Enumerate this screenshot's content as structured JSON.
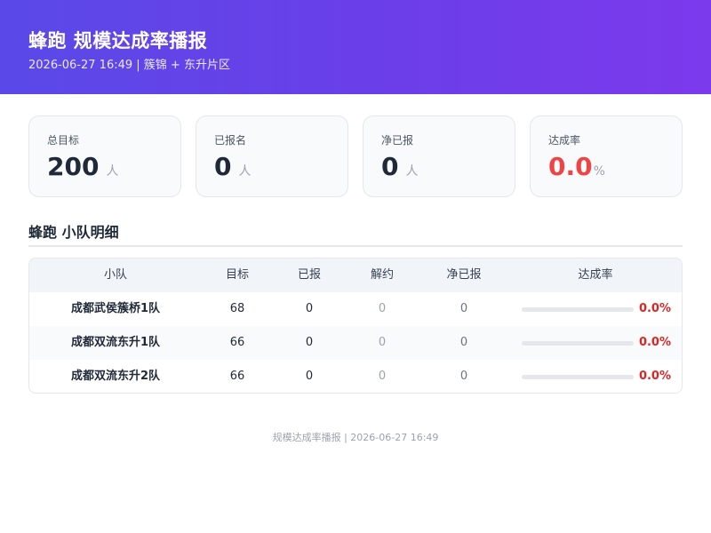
{
  "header": {
    "title": "蜂跑 规模达成率播报",
    "subtitle": "2026-06-27 16:49 | 簇锦 + 东升片区"
  },
  "stats": {
    "total": {
      "label": "总目标",
      "value": "200",
      "unit": "人"
    },
    "reported": {
      "label": "已报名",
      "value": "0",
      "unit": "人"
    },
    "net": {
      "label": "净已报",
      "value": "0",
      "unit": "人"
    },
    "rate": {
      "label": "达成率",
      "value": "0.0",
      "unit": "%",
      "color": "#ef4444"
    }
  },
  "section": {
    "title": "蜂跑 小队明细"
  },
  "table": {
    "headers": {
      "team": "小队",
      "target": "目标",
      "reported": "已报",
      "cancelled": "解约",
      "net": "净已报",
      "rate": "达成率"
    },
    "rows": [
      {
        "team": "成都武侯簇桥1队",
        "target": "68",
        "reported": "0",
        "cancelled": "0",
        "net": "0",
        "rate": "0.0%",
        "progress": 0
      },
      {
        "team": "成都双流东升1队",
        "target": "66",
        "reported": "0",
        "cancelled": "0",
        "net": "0",
        "rate": "0.0%",
        "progress": 0
      },
      {
        "team": "成都双流东升2队",
        "target": "66",
        "reported": "0",
        "cancelled": "0",
        "net": "0",
        "rate": "0.0%",
        "progress": 0
      }
    ]
  },
  "footer": {
    "text": "规模达成率播报 | 2026-06-27 16:49"
  },
  "colors": {
    "accent": "#6366f1",
    "rate_red": "#dc2626",
    "header_start": "#5a49e8",
    "header_end": "#7c3aed"
  }
}
